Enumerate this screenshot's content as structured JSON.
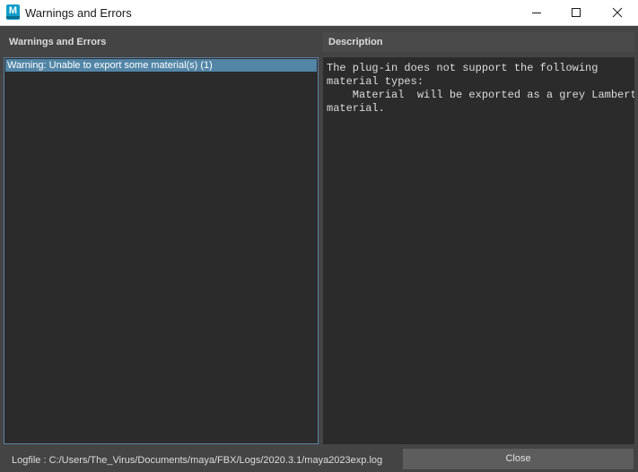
{
  "window": {
    "title": "Warnings and Errors",
    "app_icon_letter": "M"
  },
  "left_panel": {
    "header": "Warnings and Errors",
    "items": [
      {
        "label": "Warning: Unable to export some material(s) (1)",
        "selected": true
      }
    ]
  },
  "right_panel": {
    "header": "Description",
    "text": "The plug-in does not support the following\nmaterial types:\n    Material  will be exported as a grey Lambert\nmaterial."
  },
  "footer": {
    "logfile": "Logfile : C:/Users/The_Virus/Documents/maya/FBX/Logs/2020.3.1/maya2023exp.log",
    "close_label": "Close"
  },
  "colors": {
    "background": "#444444",
    "panel": "#2b2b2b",
    "selection": "#5285a6",
    "focus_border": "#5d7fa3",
    "button": "#5d5d5d",
    "app_icon": "#0f9ec9"
  },
  "icons": {
    "app": "maya-app-icon",
    "minimize": "minimize-icon",
    "maximize": "maximize-icon",
    "close": "close-icon"
  }
}
